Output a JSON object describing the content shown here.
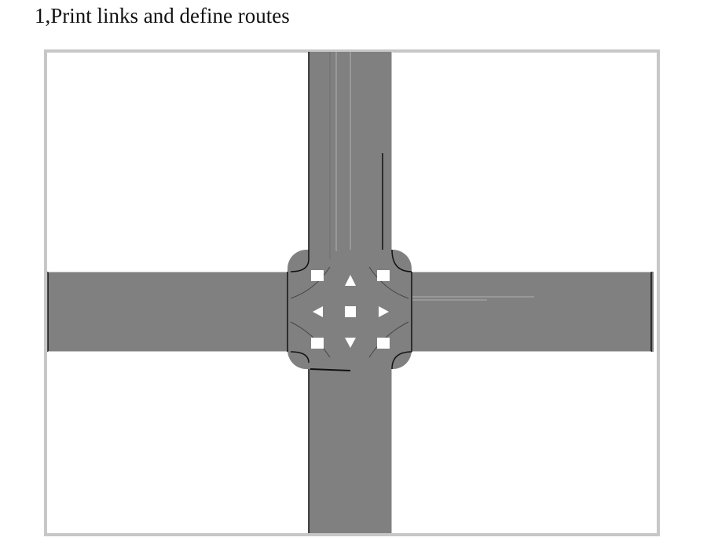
{
  "title": "1,Print links and define routes",
  "diagram": {
    "road_color": "#808080",
    "frame_color": "#c7c7c7",
    "edge_color": "#111111",
    "background": "#ffffff",
    "legs": [
      "north-road",
      "south-road",
      "west-road",
      "east-road"
    ],
    "center_markers": [
      "north-arrow",
      "south-arrow",
      "west-arrow",
      "east-arrow",
      "center-square"
    ]
  }
}
